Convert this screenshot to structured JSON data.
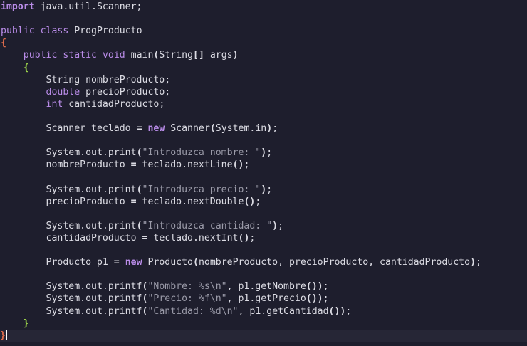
{
  "editor": {
    "lines": [
      {
        "tokens": [
          {
            "t": "import",
            "c": "kwb"
          },
          {
            "t": " java.util.Scanner;",
            "c": "plain"
          }
        ]
      },
      {
        "tokens": []
      },
      {
        "tokens": [
          {
            "t": "public",
            "c": "kw"
          },
          {
            "t": " ",
            "c": "plain"
          },
          {
            "t": "class",
            "c": "kw"
          },
          {
            "t": " ProgProducto",
            "c": "plain"
          }
        ]
      },
      {
        "tokens": [
          {
            "t": "{",
            "c": "brace-red"
          }
        ]
      },
      {
        "tokens": [
          {
            "t": "    ",
            "c": "plain"
          },
          {
            "t": "public",
            "c": "kw"
          },
          {
            "t": " ",
            "c": "plain"
          },
          {
            "t": "static",
            "c": "kw"
          },
          {
            "t": " ",
            "c": "plain"
          },
          {
            "t": "void",
            "c": "kw"
          },
          {
            "t": " main",
            "c": "plain"
          },
          {
            "t": "(",
            "c": "paren"
          },
          {
            "t": "String",
            "c": "plain"
          },
          {
            "t": "[]",
            "c": "paren"
          },
          {
            "t": " args",
            "c": "plain"
          },
          {
            "t": ")",
            "c": "paren"
          }
        ]
      },
      {
        "tokens": [
          {
            "t": "    ",
            "c": "plain"
          },
          {
            "t": "{",
            "c": "brace-grn"
          }
        ]
      },
      {
        "tokens": [
          {
            "t": "        String nombreProducto;",
            "c": "plain"
          }
        ]
      },
      {
        "tokens": [
          {
            "t": "        ",
            "c": "plain"
          },
          {
            "t": "double",
            "c": "kw"
          },
          {
            "t": " precioProducto;",
            "c": "plain"
          }
        ]
      },
      {
        "tokens": [
          {
            "t": "        ",
            "c": "plain"
          },
          {
            "t": "int",
            "c": "kw"
          },
          {
            "t": " cantidadProducto;",
            "c": "plain"
          }
        ]
      },
      {
        "tokens": []
      },
      {
        "tokens": [
          {
            "t": "        Scanner teclado ",
            "c": "plain"
          },
          {
            "t": "=",
            "c": "bold"
          },
          {
            "t": " ",
            "c": "plain"
          },
          {
            "t": "new",
            "c": "kwb"
          },
          {
            "t": " Scanner",
            "c": "plain"
          },
          {
            "t": "(",
            "c": "paren"
          },
          {
            "t": "System.in",
            "c": "plain"
          },
          {
            "t": ")",
            "c": "paren"
          },
          {
            "t": ";",
            "c": "plain"
          }
        ]
      },
      {
        "tokens": []
      },
      {
        "tokens": [
          {
            "t": "        System.out.print",
            "c": "plain"
          },
          {
            "t": "(",
            "c": "paren"
          },
          {
            "t": "\"Introduzca nombre: \"",
            "c": "str"
          },
          {
            "t": ")",
            "c": "paren"
          },
          {
            "t": ";",
            "c": "plain"
          }
        ]
      },
      {
        "tokens": [
          {
            "t": "        nombreProducto ",
            "c": "plain"
          },
          {
            "t": "=",
            "c": "bold"
          },
          {
            "t": " teclado.nextLine",
            "c": "plain"
          },
          {
            "t": "()",
            "c": "paren"
          },
          {
            "t": ";",
            "c": "plain"
          }
        ]
      },
      {
        "tokens": []
      },
      {
        "tokens": [
          {
            "t": "        System.out.print",
            "c": "plain"
          },
          {
            "t": "(",
            "c": "paren"
          },
          {
            "t": "\"Introduzca precio: \"",
            "c": "str"
          },
          {
            "t": ")",
            "c": "paren"
          },
          {
            "t": ";",
            "c": "plain"
          }
        ]
      },
      {
        "tokens": [
          {
            "t": "        precioProducto ",
            "c": "plain"
          },
          {
            "t": "=",
            "c": "bold"
          },
          {
            "t": " teclado.nextDouble",
            "c": "plain"
          },
          {
            "t": "()",
            "c": "paren"
          },
          {
            "t": ";",
            "c": "plain"
          }
        ]
      },
      {
        "tokens": []
      },
      {
        "tokens": [
          {
            "t": "        System.out.print",
            "c": "plain"
          },
          {
            "t": "(",
            "c": "paren"
          },
          {
            "t": "\"Introduzca cantidad: \"",
            "c": "str"
          },
          {
            "t": ")",
            "c": "paren"
          },
          {
            "t": ";",
            "c": "plain"
          }
        ]
      },
      {
        "tokens": [
          {
            "t": "        cantidadProducto ",
            "c": "plain"
          },
          {
            "t": "=",
            "c": "bold"
          },
          {
            "t": " teclado.nextInt",
            "c": "plain"
          },
          {
            "t": "()",
            "c": "paren"
          },
          {
            "t": ";",
            "c": "plain"
          }
        ]
      },
      {
        "tokens": []
      },
      {
        "tokens": [
          {
            "t": "        Producto p1 ",
            "c": "plain"
          },
          {
            "t": "=",
            "c": "bold"
          },
          {
            "t": " ",
            "c": "plain"
          },
          {
            "t": "new",
            "c": "kwb"
          },
          {
            "t": " Producto",
            "c": "plain"
          },
          {
            "t": "(",
            "c": "paren"
          },
          {
            "t": "nombreProducto, precioProducto, cantidadProducto",
            "c": "plain"
          },
          {
            "t": ")",
            "c": "paren"
          },
          {
            "t": ";",
            "c": "plain"
          }
        ]
      },
      {
        "tokens": []
      },
      {
        "tokens": [
          {
            "t": "        System.out.printf",
            "c": "plain"
          },
          {
            "t": "(",
            "c": "paren"
          },
          {
            "t": "\"Nombre: %s\\n\"",
            "c": "str"
          },
          {
            "t": ", p1.getNombre",
            "c": "plain"
          },
          {
            "t": "())",
            "c": "paren"
          },
          {
            "t": ";",
            "c": "plain"
          }
        ]
      },
      {
        "tokens": [
          {
            "t": "        System.out.printf",
            "c": "plain"
          },
          {
            "t": "(",
            "c": "paren"
          },
          {
            "t": "\"Precio: %f\\n\"",
            "c": "str"
          },
          {
            "t": ", p1.getPrecio",
            "c": "plain"
          },
          {
            "t": "())",
            "c": "paren"
          },
          {
            "t": ";",
            "c": "plain"
          }
        ]
      },
      {
        "tokens": [
          {
            "t": "        System.out.printf",
            "c": "plain"
          },
          {
            "t": "(",
            "c": "paren"
          },
          {
            "t": "\"Cantidad: %d\\n\"",
            "c": "str"
          },
          {
            "t": ", p1.getCantidad",
            "c": "plain"
          },
          {
            "t": "())",
            "c": "paren"
          },
          {
            "t": ";",
            "c": "plain"
          }
        ]
      },
      {
        "tokens": [
          {
            "t": "    ",
            "c": "plain"
          },
          {
            "t": "}",
            "c": "brace-grn"
          }
        ]
      },
      {
        "tokens": [
          {
            "t": "}",
            "c": "brace-red"
          }
        ],
        "current": true,
        "caret": true
      }
    ],
    "colors": {
      "background": "#1e1e2d",
      "keyword": "#b98ce8",
      "string": "#9a9aa8",
      "text": "#dcdce4",
      "brace_outer": "#e06c4c",
      "brace_inner": "#9ad04a"
    }
  }
}
